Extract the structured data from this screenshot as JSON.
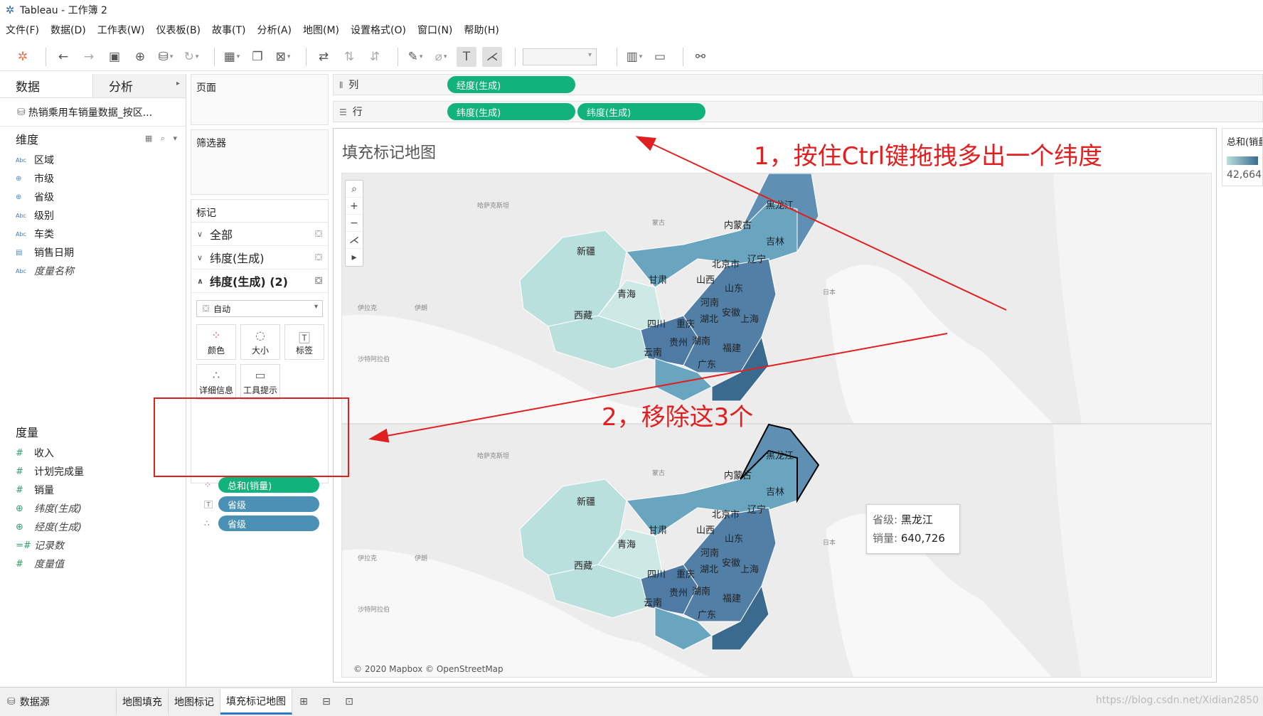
{
  "window": {
    "title": "Tableau - 工作簿 2"
  },
  "menu": [
    "文件(F)",
    "数据(D)",
    "工作表(W)",
    "仪表板(B)",
    "故事(T)",
    "分析(A)",
    "地图(M)",
    "设置格式(O)",
    "窗口(N)",
    "帮助(H)"
  ],
  "data_pane": {
    "tab_data": "数据",
    "tab_analysis": "分析",
    "datasource": "热销乘用车销量数据_按区...",
    "dimensions_title": "维度",
    "dimensions": [
      {
        "icon": "Abc",
        "label": "区域"
      },
      {
        "icon": "⊕",
        "label": "市级"
      },
      {
        "icon": "⊕",
        "label": "省级"
      },
      {
        "icon": "Abc",
        "label": "级别"
      },
      {
        "icon": "Abc",
        "label": "车类"
      },
      {
        "icon": "▤",
        "label": "销售日期"
      },
      {
        "icon": "Abc",
        "label": "度量名称"
      }
    ],
    "measures_title": "度量",
    "measures": [
      {
        "icon": "#",
        "label": "收入"
      },
      {
        "icon": "#",
        "label": "计划完成量"
      },
      {
        "icon": "#",
        "label": "销量"
      },
      {
        "icon": "⊕",
        "label": "纬度(生成)"
      },
      {
        "icon": "⊕",
        "label": "经度(生成)"
      },
      {
        "icon": "=#",
        "label": "记录数"
      },
      {
        "icon": "#",
        "label": "度量值"
      }
    ]
  },
  "shelves": {
    "pages": "页面",
    "filters": "筛选器",
    "marks": "标记",
    "columns_label": "列",
    "rows_label": "行",
    "columns_pills": [
      "经度(生成)"
    ],
    "rows_pills": [
      "纬度(生成)",
      "纬度(生成)"
    ]
  },
  "marks_card": {
    "all": "全部",
    "lat1": "纬度(生成)",
    "lat2": "纬度(生成) (2)",
    "mark_type": "自动",
    "buttons": [
      "颜色",
      "大小",
      "标签",
      "详细信息",
      "工具提示"
    ],
    "pills": [
      {
        "icon": "color",
        "label": "总和(销量)",
        "style": "green"
      },
      {
        "icon": "label",
        "label": "省级",
        "style": "blue"
      },
      {
        "icon": "detail",
        "label": "省级",
        "style": "blue"
      }
    ]
  },
  "view": {
    "title": "填充标记地图",
    "attribution": "© 2020 Mapbox © OpenStreetMap",
    "map_labels": [
      "哈萨克斯坦",
      "蒙古",
      "新疆",
      "内蒙古",
      "黑龙江",
      "吉林",
      "辽宁",
      "北京市",
      "甘肃",
      "青海",
      "山西",
      "山东",
      "河南",
      "安徽",
      "湖北",
      "上海",
      "四川",
      "重庆",
      "西藏",
      "贵州",
      "湖南",
      "福建",
      "云南",
      "广东",
      "伊拉克",
      "伊朗",
      "沙特阿拉伯",
      "日本"
    ],
    "tooltip": {
      "k1": "省级:",
      "v1": "黑龙江",
      "k2": "销量:",
      "v2": "640,726"
    }
  },
  "legend": {
    "title": "总和(销量)",
    "min_value": "42,664"
  },
  "annotations": {
    "step1": "1，按住Ctrl键拖拽多出一个纬度",
    "step2": "2，移除这3个"
  },
  "bottom_tabs": {
    "datasource": "数据源",
    "sheets": [
      "地图填充",
      "地图标记",
      "填充标记地图"
    ],
    "active": "填充标记地图"
  },
  "watermark": "https://blog.csdn.net/Xidian2850",
  "colors": {
    "accent_green": "#11b27c",
    "pill_blue": "#4a91b5",
    "annotation_red": "#e02020",
    "map_light": "#b9e0dd",
    "map_dark": "#3b6a8f"
  }
}
